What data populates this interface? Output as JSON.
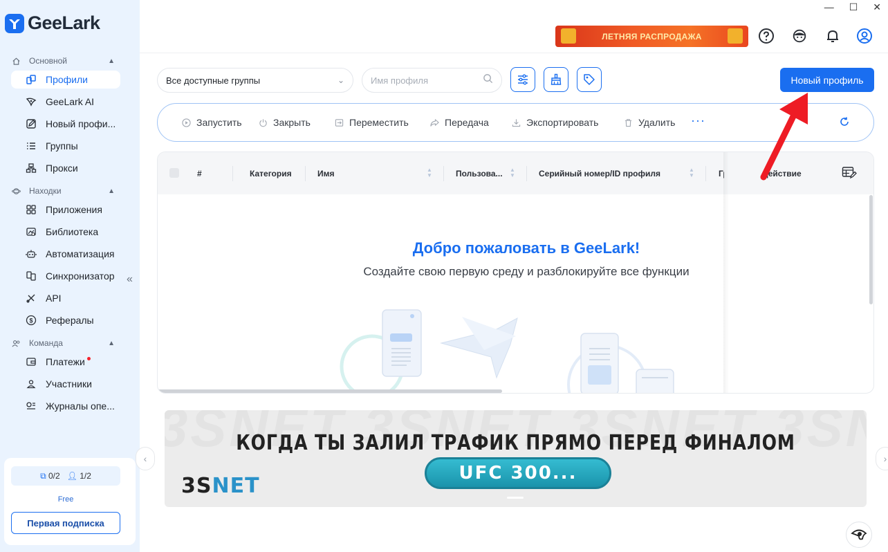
{
  "app": {
    "name": "GeeLark"
  },
  "window": {
    "minimize": "—",
    "maximize": "☐",
    "close": "✕"
  },
  "header": {
    "promo_text": "ЛЕТНЯЯ РАСПРОДАЖА"
  },
  "sidebar": {
    "sections": [
      {
        "title": "Основной",
        "items": [
          {
            "label": "Профили",
            "icon": "profiles-icon",
            "active": true
          },
          {
            "label": "GeeLark AI",
            "icon": "ai-icon"
          },
          {
            "label": "Новый профи...",
            "icon": "edit-icon"
          },
          {
            "label": "Группы",
            "icon": "list-icon"
          },
          {
            "label": "Прокси",
            "icon": "proxy-icon"
          }
        ]
      },
      {
        "title": "Находки",
        "items": [
          {
            "label": "Приложения",
            "icon": "apps-icon"
          },
          {
            "label": "Библиотека",
            "icon": "library-icon"
          },
          {
            "label": "Автоматизация",
            "icon": "robot-icon"
          },
          {
            "label": "Синхронизатор",
            "icon": "sync-icon"
          },
          {
            "label": "API",
            "icon": "api-icon"
          },
          {
            "label": "Рефералы",
            "icon": "dollar-icon"
          }
        ]
      },
      {
        "title": "Команда",
        "items": [
          {
            "label": "Платежи",
            "icon": "wallet-icon",
            "badge": true
          },
          {
            "label": "Участники",
            "icon": "user-icon"
          },
          {
            "label": "Журналы опе...",
            "icon": "logs-icon"
          }
        ]
      }
    ],
    "plan": {
      "profiles": "0/2",
      "members": "1/2",
      "tier": "Free",
      "button": "Первая подписка"
    }
  },
  "toolbar": {
    "group_select": "Все доступные группы",
    "search_placeholder": "Имя профиля",
    "new_profile": "Новый профиль"
  },
  "actions": [
    "Запустить",
    "Закрыть",
    "Переместить",
    "Передача",
    "Экспортировать",
    "Удалить"
  ],
  "table": {
    "columns": [
      "#",
      "Категория",
      "Имя",
      "Пользова...",
      "Серийный номер/ID профиля",
      "Гр",
      "Действие"
    ]
  },
  "empty_state": {
    "title": "Добро пожаловать в GeeLark!",
    "subtitle": "Создайте свою первую среду и разблокируйте все функции"
  },
  "banner": {
    "title": "КОГДА ТЫ ЗАЛИЛ ТРАФИК ПРЯМО ПЕРЕД ФИНАЛОМ",
    "pill": "UFC 300...",
    "logo_a": "3S",
    "logo_b": "NET",
    "watermark": "3SNET 3SNET 3SNET 3SNET 3SNET 3SNET"
  },
  "colors": {
    "accent": "#1a6ef0",
    "sidebar_bg": "#eaf3fe",
    "arrow": "#ee1c25"
  }
}
